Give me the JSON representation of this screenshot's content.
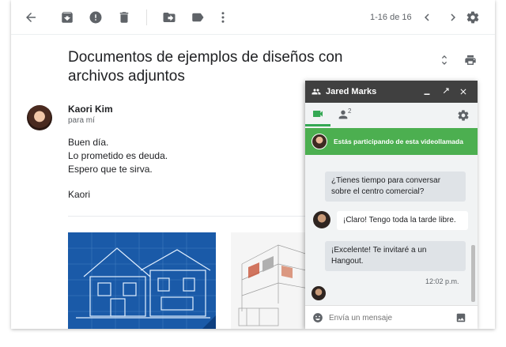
{
  "toolbar": {
    "icons": [
      "back-icon",
      "archive-icon",
      "report-spam-icon",
      "delete-icon",
      "move-to-icon",
      "label-icon",
      "more-icon",
      "prev-icon",
      "next-icon",
      "settings-icon"
    ],
    "pager": "1-16 de 16"
  },
  "email": {
    "subject": "Documentos de ejemplos de diseños con archivos adjuntos",
    "sender": "Kaori Kim",
    "to": "para mí",
    "body": [
      "Buen día.",
      "Lo prometido es deuda.",
      "Espero que te sirva.",
      "Kaori"
    ]
  },
  "chat": {
    "contact": "Jared Marks",
    "people_badge": "2",
    "banner": "Estás participando de esta videollamada",
    "messages": [
      {
        "text": "¿Tienes tiempo para conversar sobre el centro comercial?",
        "from": "me"
      },
      {
        "text": "¡Claro! Tengo toda la tarde libre.",
        "from": "contact"
      },
      {
        "text": "¡Excelente! Te invitaré a un Hangout.",
        "from": "me"
      }
    ],
    "time": "12:02 p.m.",
    "input_placeholder": "Envía un mensaje"
  },
  "colors": {
    "accent_green": "#4caf50",
    "chat_header": "#404040",
    "blueprint": "#1a5aa8"
  }
}
